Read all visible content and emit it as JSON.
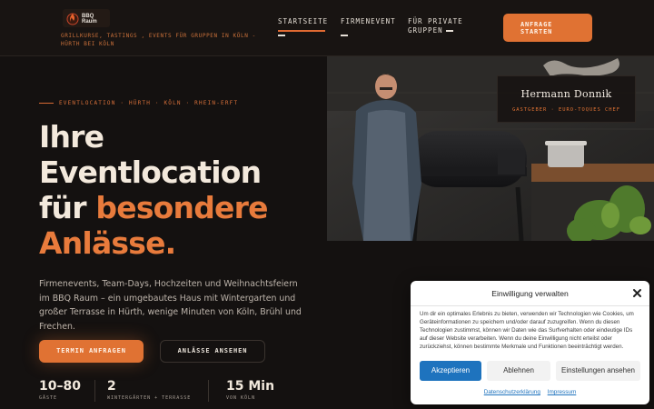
{
  "header": {
    "logo_text": "BBQ Raum",
    "tagline": "Grillkurse, Tastings , Events für Gruppen in Köln - Hürth bei Köln",
    "nav": [
      {
        "label": "STARTSEITE"
      },
      {
        "label": "FIRMENEVENT"
      },
      {
        "label_line1": "FÜR PRIVATE",
        "label_line2": "GRUPPEN"
      }
    ],
    "cta": {
      "line1": "ANFRAGE",
      "line2": "STARTEN"
    }
  },
  "hero": {
    "eyebrow": "EVENTLOCATION · HÜRTH · KÖLN · RHEIN-ERFT",
    "headline": {
      "line1": "Ihre",
      "line2": "Eventlocation",
      "line3_plain": "für ",
      "line3_accent": "besondere",
      "line4_accent": "Anlässe."
    },
    "intro": "Firmenevents, Team-Days, Hochzeiten und Weihnachtsfeiern im BBQ Raum – ein umgebautes Haus mit Wintergarten und großer Terrasse in Hürth, wenige Minuten von Köln, Brühl und Frechen.",
    "primary_button": "TERMIN ANFRAGEN",
    "secondary_button": "ANLÄSSE ANSEHEN",
    "stats": [
      {
        "value": "10–80",
        "label": "GÄSTE"
      },
      {
        "value": "2",
        "label": "WINTERGÄRTEN + TERRASSE"
      },
      {
        "value": "15 Min",
        "label": "VON KÖLN"
      }
    ]
  },
  "host_card": {
    "name": "Hermann Donnik",
    "role": "GASTGEBER · EURO-TOQUES CHEF"
  },
  "consent": {
    "title": "Einwilligung verwalten",
    "body": "Um dir ein optimales Erlebnis zu bieten, verwenden wir Technologien wie Cookies, um Geräteinformationen zu speichern und/oder darauf zuzugreifen. Wenn du diesen Technologien zustimmst, können wir Daten wie das Surfverhalten oder eindeutige IDs auf dieser Website verarbeiten. Wenn du deine Einwilligung nicht erteilst oder zurückziehst, können bestimmte Merkmale und Funktionen beeinträchtigt werden.",
    "accept": "Akzeptieren",
    "deny": "Ablehnen",
    "preferences": "Einstellungen ansehen",
    "links": [
      "Datenschutzerklärung",
      "Impressum"
    ]
  },
  "colors": {
    "background": "#141110",
    "accent": "#e07233",
    "consent_primary": "#1e73be"
  }
}
